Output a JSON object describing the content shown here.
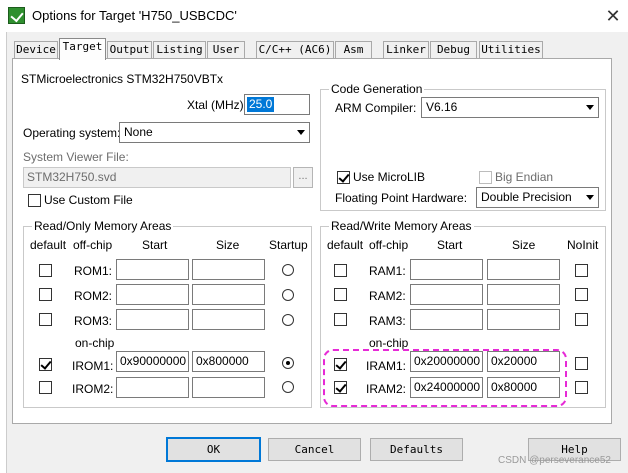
{
  "window": {
    "title": "Options for Target 'H750_USBCDC'",
    "close_glyph": "✕"
  },
  "tabs": [
    "Device",
    "Target",
    "Output",
    "Listing",
    "User",
    "C/C++ (AC6)",
    "Asm",
    "Linker",
    "Debug",
    "Utilities"
  ],
  "active_tab": "Target",
  "device": {
    "name": "STMicroelectronics STM32H750VBTx"
  },
  "xtal": {
    "label": "Xtal (MHz):",
    "value": "25.0"
  },
  "os": {
    "label": "Operating system:",
    "value": "None"
  },
  "svd": {
    "label": "System Viewer File:",
    "value": "STM32H750.svd",
    "browse": "...",
    "custom_label": "Use Custom File",
    "custom_checked": false
  },
  "codegen": {
    "title": "Code Generation",
    "compiler_label": "ARM Compiler:",
    "compiler_value": "V6.16",
    "microlib_label": "Use MicroLIB",
    "microlib_checked": true,
    "big_endian_label": "Big Endian",
    "big_endian_checked": false,
    "fp_label": "Floating Point Hardware:",
    "fp_value": "Double Precision"
  },
  "ro": {
    "title": "Read/Only Memory Areas",
    "headers": {
      "default": "default",
      "offchip": "off-chip",
      "start": "Start",
      "size": "Size",
      "startup": "Startup"
    },
    "onchip_label": "on-chip",
    "rows": [
      {
        "name": "ROM1:",
        "start": "",
        "size": "",
        "default": false,
        "startup": false
      },
      {
        "name": "ROM2:",
        "start": "",
        "size": "",
        "default": false,
        "startup": false
      },
      {
        "name": "ROM3:",
        "start": "",
        "size": "",
        "default": false,
        "startup": false
      },
      {
        "name": "IROM1:",
        "start": "0x90000000",
        "size": "0x800000",
        "default": true,
        "startup": true
      },
      {
        "name": "IROM2:",
        "start": "",
        "size": "",
        "default": false,
        "startup": false
      }
    ]
  },
  "rw": {
    "title": "Read/Write Memory Areas",
    "headers": {
      "default": "default",
      "offchip": "off-chip",
      "start": "Start",
      "size": "Size",
      "noinit": "NoInit"
    },
    "onchip_label": "on-chip",
    "rows": [
      {
        "name": "RAM1:",
        "start": "",
        "size": "",
        "default": false,
        "noinit": false
      },
      {
        "name": "RAM2:",
        "start": "",
        "size": "",
        "default": false,
        "noinit": false
      },
      {
        "name": "RAM3:",
        "start": "",
        "size": "",
        "default": false,
        "noinit": false
      },
      {
        "name": "IRAM1:",
        "start": "0x20000000",
        "size": "0x20000",
        "default": true,
        "noinit": false
      },
      {
        "name": "IRAM2:",
        "start": "0x24000000",
        "size": "0x80000",
        "default": true,
        "noinit": false
      }
    ]
  },
  "buttons": {
    "ok": "OK",
    "cancel": "Cancel",
    "defaults": "Defaults",
    "help": "Help"
  },
  "watermark": "CSDN @perseverance52",
  "colors": {
    "highlight": "#e62ad6",
    "accent": "#0078d7"
  }
}
